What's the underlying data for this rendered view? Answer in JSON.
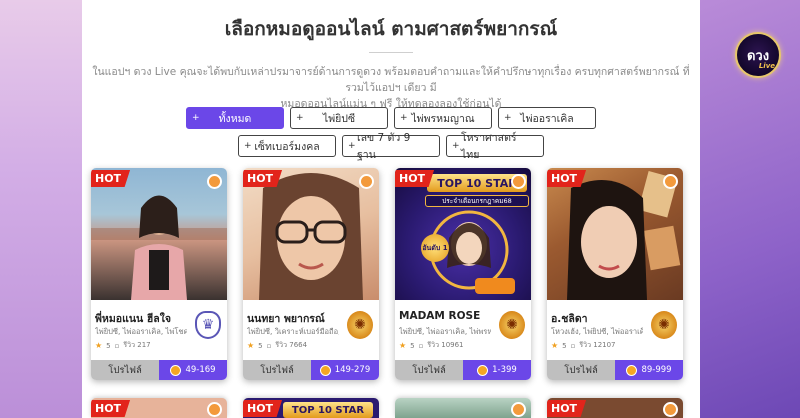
{
  "page": {
    "title": "เลือกหมอดูออนไลน์ ตามศาสตร์พยากรณ์",
    "description_line1": "ในแอปฯ ดวง Live คุณจะได้พบกับเหล่าปรมาจารย์ด้านการดูดวง พร้อมตอบคำถามและให้คำปรึกษาทุกเรื่อง ครบทุกศาสตร์พยากรณ์ ที่รวมไว้แอปฯ เดียว มี",
    "description_line2": "หมอดูออนไลน์แม่น ๆ ฟรี ให้ทดลองลองใช้ก่อนได้"
  },
  "logo": {
    "text": "ดวง",
    "sub": "Live"
  },
  "filters": {
    "row1": [
      {
        "label": "ทั้งหมด",
        "active": true
      },
      {
        "label": "ไพ่ยิปซี",
        "active": false
      },
      {
        "label": "ไพ่พรหมญาณ",
        "active": false
      },
      {
        "label": "ไพ่ออราเคิล",
        "active": false
      }
    ],
    "row2": [
      {
        "label": "เซ็ทเบอร์มงคล",
        "active": false
      },
      {
        "label": "เลข 7 ตัว 9 ฐาน",
        "active": false
      },
      {
        "label": "โหราศาสตร์ไทย",
        "active": false
      }
    ]
  },
  "cards": [
    {
      "hot": "HOT",
      "name": "พี่หมอแนน ฮีลใจ",
      "skills": "ไพ่ยิปซี, ไพ่ออราเคิล, ไพ่โชคดี",
      "rating": "5",
      "reviews": "รีวิว 217",
      "profile": "โปรไฟล์",
      "price": "49-169",
      "badge": "shield",
      "photo_colors": [
        "#7fa9c9",
        "#c98a7a",
        "#2f2b2a"
      ]
    },
    {
      "hot": "HOT",
      "name": "นนทยา พยากรณ์",
      "skills": "ไพ่ยิปซี, วิเคราะห์เบอร์มือถือ, ไ",
      "rating": "5",
      "reviews": "รีวิว 7664",
      "profile": "โปรไฟล์",
      "price": "149-279",
      "badge": "ganesh",
      "photo_colors": [
        "#e8c3a2",
        "#d59878",
        "#5c3a2a"
      ]
    },
    {
      "hot": "HOT",
      "name": "MADAM ROSE",
      "skills": "ไพ่ยิปซี, ไพ่ออราเคิล, ไพ่พรหม",
      "rating": "5",
      "reviews": "รีวิว 10961",
      "profile": "โปรไฟล์",
      "price": "1-399",
      "badge": "ganesh",
      "photo_colors": [
        "#2d1a6e",
        "#e6a632",
        "#1b0f45"
      ],
      "banner": "TOP 10 STAR",
      "banner_sub": "ประจำเดือนกรกฎาคม68",
      "rank": "อันดับ 1"
    },
    {
      "hot": "HOT",
      "name": "อ.ชลิดา",
      "skills": "โหวงเฮ้ง, ไพ่ยิปซี, ไพ่ออราเคิ",
      "rating": "5",
      "reviews": "รีวิว 12107",
      "profile": "โปรไฟล์",
      "price": "89-999",
      "badge": "ganesh",
      "photo_colors": [
        "#b46b3a",
        "#e9c2a6",
        "#3a2216"
      ]
    }
  ],
  "row2": [
    {
      "hot": "HOT"
    },
    {
      "hot": "HOT",
      "banner": "TOP 10 STAR"
    },
    {
      "hot": ""
    },
    {
      "hot": "HOT"
    }
  ]
}
